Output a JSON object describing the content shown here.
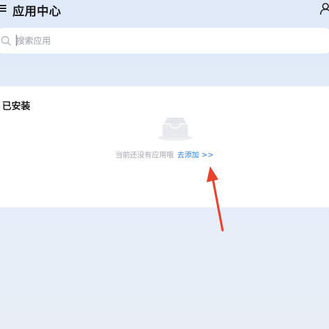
{
  "header": {
    "title": "应用中心",
    "menu_icon": "hamburger-menu-icon",
    "user_icon": "user-icon"
  },
  "search": {
    "placeholder": "搜索应用",
    "value": "",
    "icon": "search-icon"
  },
  "installed": {
    "section_title": "已安装",
    "empty_icon": "empty-inbox-icon",
    "empty_message": "当前还没有应用哦",
    "add_link": "去添加 >>"
  },
  "annotation": {
    "type": "arrow",
    "color": "#e8432d"
  },
  "colors": {
    "background": "#e3ecf8",
    "card": "#ffffff",
    "link": "#2f80ed"
  }
}
